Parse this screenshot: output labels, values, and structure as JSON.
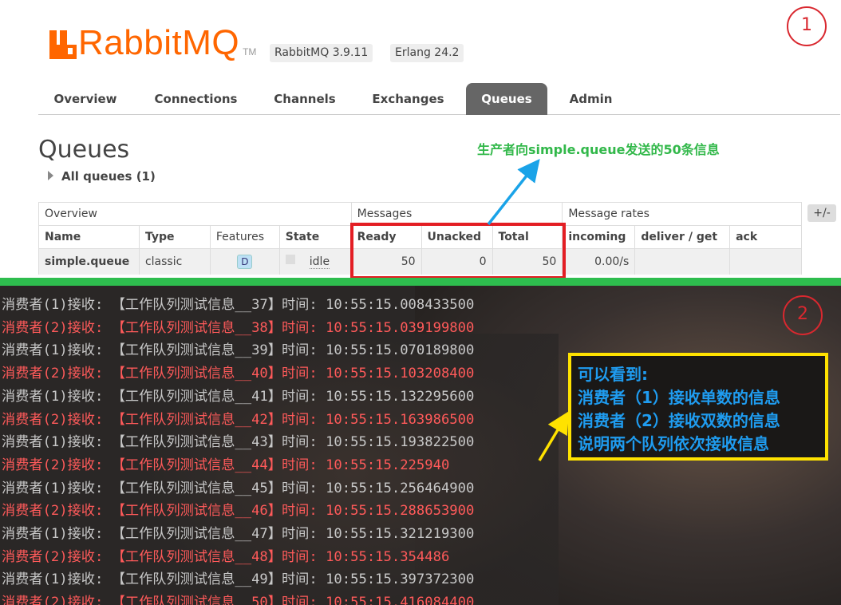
{
  "brand": {
    "name": "RabbitMQ",
    "tm": "TM"
  },
  "versions": {
    "rabbitmq": "RabbitMQ 3.9.11",
    "erlang": "Erlang 24.2"
  },
  "markers": {
    "one": "1",
    "two": "2"
  },
  "nav": {
    "tabs": [
      {
        "label": "Overview"
      },
      {
        "label": "Connections"
      },
      {
        "label": "Channels"
      },
      {
        "label": "Exchanges"
      },
      {
        "label": "Queues",
        "active": true
      },
      {
        "label": "Admin"
      }
    ]
  },
  "page": {
    "title": "Queues",
    "all_queues": "All queues (1)"
  },
  "annotations": {
    "top": "生产者向simple.queue发送的50条信息",
    "bottom": [
      "可以看到:",
      "消费者（1）接收单数的信息",
      "消费者（2）接收双数的信息",
      "说明两个队列依次接收信息"
    ]
  },
  "table": {
    "groups": [
      "Overview",
      "Messages",
      "Message rates"
    ],
    "columns": [
      "Name",
      "Type",
      "Features",
      "State",
      "Ready",
      "Unacked",
      "Total",
      "incoming",
      "deliver / get",
      "ack"
    ],
    "plus_minus": "+/-",
    "rows": [
      {
        "name": "simple.queue",
        "type": "classic",
        "features": "D",
        "state": "idle",
        "ready": "50",
        "unacked": "0",
        "total": "50",
        "incoming": "0.00/s",
        "deliver_get": "",
        "ack": ""
      }
    ]
  },
  "console": {
    "lines": [
      {
        "consumer": "消费者(1)接收:",
        "message": "【工作队列测试信息__37】",
        "time_label": "时间:",
        "time": "10:55:15.008433500"
      },
      {
        "consumer": "消费者(2)接收:",
        "message": "【工作队列测试信息__38】",
        "time_label": "时间:",
        "time": "10:55:15.039199800"
      },
      {
        "consumer": "消费者(1)接收:",
        "message": "【工作队列测试信息__39】",
        "time_label": "时间:",
        "time": "10:55:15.070189800"
      },
      {
        "consumer": "消费者(2)接收:",
        "message": "【工作队列测试信息__40】",
        "time_label": "时间:",
        "time": "10:55:15.103208400"
      },
      {
        "consumer": "消费者(1)接收:",
        "message": "【工作队列测试信息__41】",
        "time_label": "时间:",
        "time": "10:55:15.132295600"
      },
      {
        "consumer": "消费者(2)接收:",
        "message": "【工作队列测试信息__42】",
        "time_label": "时间:",
        "time": "10:55:15.163986500"
      },
      {
        "consumer": "消费者(1)接收:",
        "message": "【工作队列测试信息__43】",
        "time_label": "时间:",
        "time": "10:55:15.193822500"
      },
      {
        "consumer": "消费者(2)接收:",
        "message": "【工作队列测试信息__44】",
        "time_label": "时间:",
        "time": "10:55:15.225940"
      },
      {
        "consumer": "消费者(1)接收:",
        "message": "【工作队列测试信息__45】",
        "time_label": "时间:",
        "time": "10:55:15.256464900"
      },
      {
        "consumer": "消费者(2)接收:",
        "message": "【工作队列测试信息__46】",
        "time_label": "时间:",
        "time": "10:55:15.288653900"
      },
      {
        "consumer": "消费者(1)接收:",
        "message": "【工作队列测试信息__47】",
        "time_label": "时间:",
        "time": "10:55:15.321219300"
      },
      {
        "consumer": "消费者(2)接收:",
        "message": "【工作队列测试信息__48】",
        "time_label": "时间:",
        "time": "10:55:15.354486"
      },
      {
        "consumer": "消费者(1)接收:",
        "message": "【工作队列测试信息__49】",
        "time_label": "时间:",
        "time": "10:55:15.397372300"
      },
      {
        "consumer": "消费者(2)接收:",
        "message": "【工作队列测试信息__50】",
        "time_label": "时间:",
        "time": "10:55:15.416084400"
      }
    ]
  },
  "colors": {
    "brand": "#ff6600",
    "annot_green": "#32b84a",
    "highlight_red": "#e31e24",
    "console_red": "#ff5a5a",
    "note_blue": "#1f9cf0",
    "note_yellow": "#ffe200",
    "console_bar": "#2ebd4e"
  }
}
